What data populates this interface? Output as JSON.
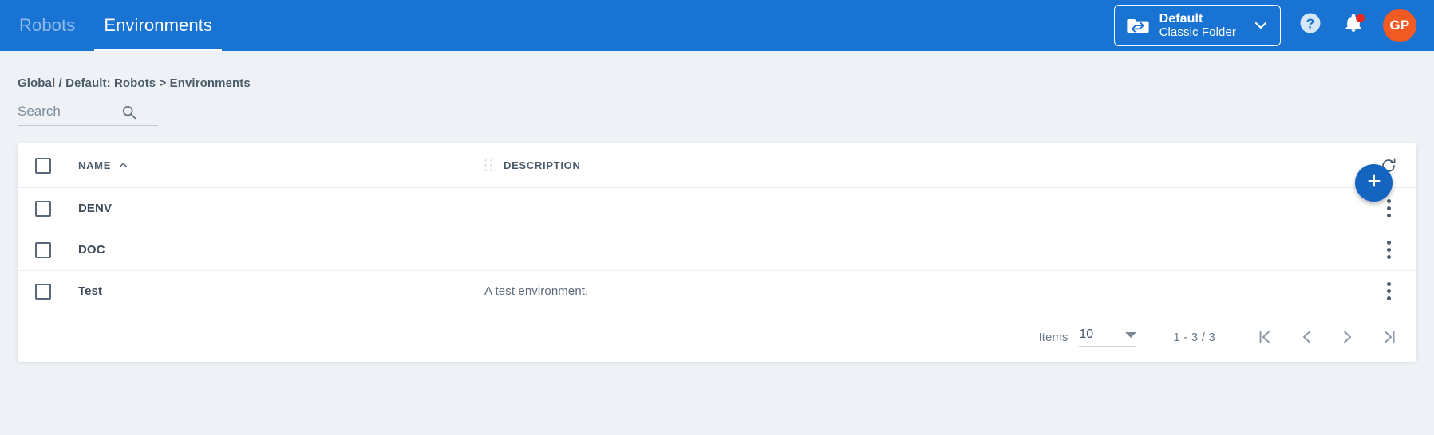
{
  "appbar": {
    "tabs": [
      {
        "label": "Robots",
        "active": false
      },
      {
        "label": "Environments",
        "active": true
      }
    ],
    "folder_selector": {
      "icon": "folder-swap-icon",
      "title": "Default",
      "subtitle": "Classic Folder",
      "chevron_icon": "chevron-down-icon"
    },
    "help_icon": "help-circle-icon",
    "notifications_icon": "bell-icon",
    "notification_badge": true,
    "avatar_initials": "GP",
    "colors": {
      "appbar_blue": "#1873D3",
      "avatar_orange": "#F15A22",
      "badge_red": "#E8281E",
      "fab_blue": "#1565C0",
      "page_bg": "#EEF2F6"
    }
  },
  "page": {
    "breadcrumb": "Global / Default: Robots > Environments",
    "search": {
      "placeholder": "Search",
      "value": "",
      "icon": "search-icon"
    },
    "fab": {
      "label": "+",
      "icon": "plus-icon"
    },
    "refresh": {
      "icon": "refresh-icon"
    }
  },
  "table": {
    "select_all_checkbox": false,
    "columns": [
      {
        "key": "name",
        "label": "NAME",
        "sorted": true,
        "sort_direction": "asc",
        "sort_icon": "chevron-up-icon"
      },
      {
        "key": "description",
        "label": "DESCRIPTION",
        "sorted": false,
        "drag_handle_icon": "drag-handle-icon"
      }
    ],
    "rows": [
      {
        "checked": false,
        "name": "DENV",
        "description": "",
        "menu_icon": "kebab-menu-icon"
      },
      {
        "checked": false,
        "name": "DOC",
        "description": "",
        "menu_icon": "kebab-menu-icon"
      },
      {
        "checked": false,
        "name": "Test",
        "description": "A test environment.",
        "menu_icon": "kebab-menu-icon"
      }
    ]
  },
  "pagination": {
    "items_label": "Items",
    "page_size": "10",
    "page_size_caret_icon": "caret-down-icon",
    "range": "1 - 3 / 3",
    "first_icon": "first-page-icon",
    "prev_icon": "prev-page-icon",
    "next_icon": "next-page-icon",
    "last_icon": "last-page-icon"
  }
}
